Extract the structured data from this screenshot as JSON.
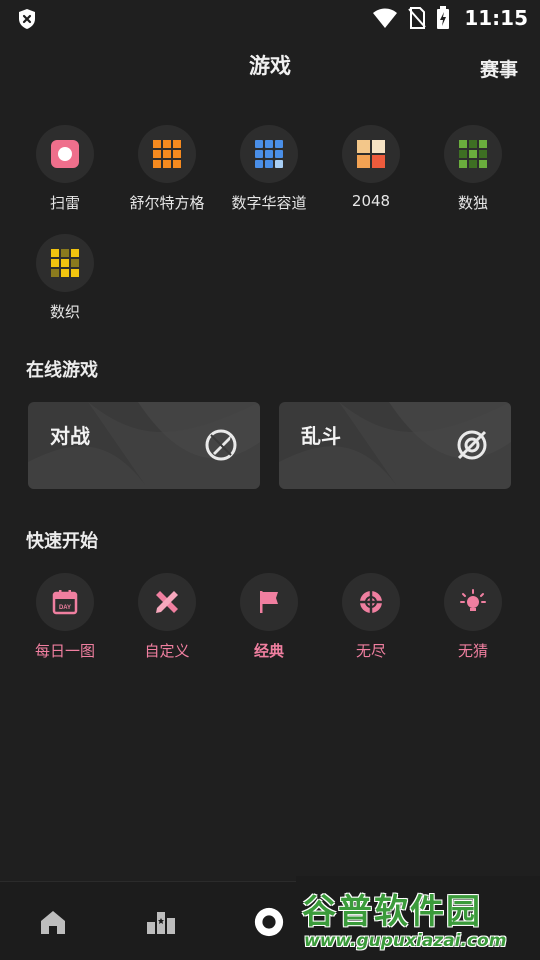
{
  "status_bar": {
    "time": "11:15"
  },
  "header": {
    "title": "游戏",
    "action": "赛事"
  },
  "games": [
    {
      "label": "扫雷",
      "icon": "minesweeper-icon"
    },
    {
      "label": "舒尔特方格",
      "icon": "schulte-grid-icon"
    },
    {
      "label": "数字华容道",
      "icon": "number-slider-icon"
    },
    {
      "label": "2048",
      "icon": "2048-icon"
    },
    {
      "label": "数独",
      "icon": "sudoku-icon"
    },
    {
      "label": "数织",
      "icon": "nonogram-icon"
    }
  ],
  "online": {
    "title": "在线游戏",
    "cards": [
      {
        "label": "对战",
        "icon": "battle-icon"
      },
      {
        "label": "乱斗",
        "icon": "brawl-icon"
      }
    ]
  },
  "quick": {
    "title": "快速开始",
    "items": [
      {
        "label": "每日一图",
        "icon": "calendar-day-icon"
      },
      {
        "label": "自定义",
        "icon": "ruler-pencil-icon"
      },
      {
        "label": "经典",
        "icon": "flag-icon"
      },
      {
        "label": "无尽",
        "icon": "crosshair-icon"
      },
      {
        "label": "无猜",
        "icon": "lightbulb-icon"
      }
    ]
  },
  "bottom_nav": [
    {
      "name": "home-icon"
    },
    {
      "name": "leaderboard-icon"
    },
    {
      "name": "game-icon"
    }
  ],
  "watermark": {
    "brand": "谷普软件园",
    "url": "www.gupuxiazai.com"
  },
  "colors": {
    "accent": "#f07fa0",
    "background": "#1f1f1f",
    "card": "#3a3a3a"
  }
}
